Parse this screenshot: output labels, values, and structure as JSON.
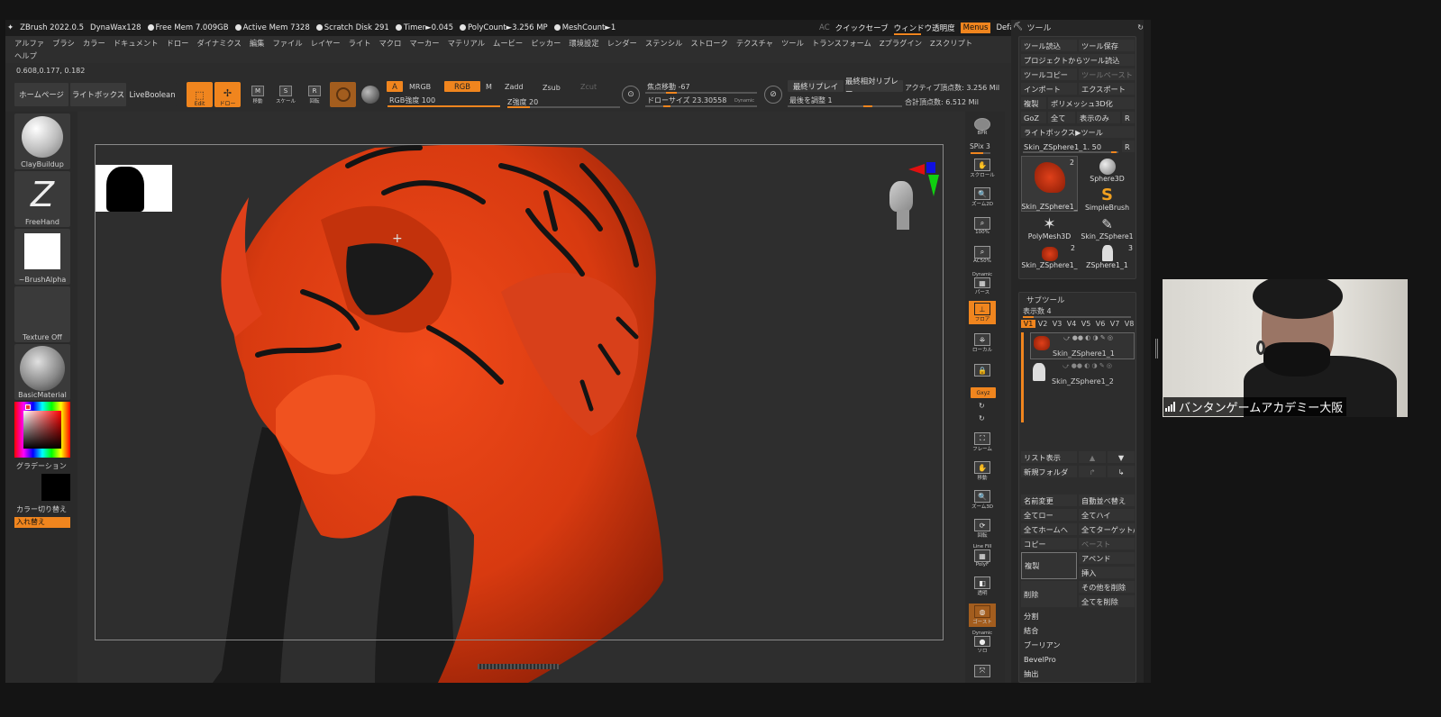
{
  "titlebar": {
    "items": [
      "ZBrush 2022.0.5",
      "DynaWax128"
    ],
    "stats": [
      "Free Mem 7.009GB",
      "Active Mem 7328",
      "Scratch Disk 291",
      "Timer►0.045",
      "PolyCount►3.256 MP",
      "MeshCount►1"
    ],
    "right": {
      "ac": "AC",
      "quicksave": "クイックセーブ",
      "transparency": "ウィンドウ透明度",
      "menus": "Menus",
      "script": "DefaultZScript"
    }
  },
  "menu": {
    "row1": [
      "アルファ",
      "ブラシ",
      "カラー",
      "ドキュメント",
      "ドロー",
      "ダイナミクス",
      "編集",
      "ファイル",
      "レイヤー",
      "ライト",
      "マクロ",
      "マーカー",
      "マテリアル",
      "ムービー",
      "ピッカー",
      "環境設定",
      "レンダー",
      "ステンシル",
      "ストローク",
      "テクスチャ",
      "ツール",
      "トランスフォーム",
      "Zプラグイン",
      "Zスクリプト"
    ],
    "row2": [
      "ヘルプ"
    ]
  },
  "coords": "0.608,0.177, 0.182",
  "toolbar": {
    "home": "ホームページ",
    "lightbox": "ライトボックス",
    "liveboolean": "LiveBoolean",
    "edit": "Edit",
    "draw": "ドロー",
    "move": "移動",
    "scale": "スケール",
    "rotate": "回転",
    "a": "A",
    "mrgb": "MRGB",
    "rgb": "RGB",
    "m": "M",
    "zadd": "Zadd",
    "zsub": "Zsub",
    "zcut": "Zcut",
    "rgb_intensity": "RGB強度 100",
    "z_intensity": "Z強度 20",
    "focal_shift": "焦点移動 -67",
    "draw_size": "ドローサイズ 23.30558",
    "dynamic": "Dynamic",
    "last_replay": "最終リプレイ",
    "last_relative_replay": "最終相対リプレー",
    "adjust_last": "最後を調整 1",
    "active_points": "アクティブ頂点数: 3.256 Mil",
    "total_points": "合計頂点数: 6.512 Mil",
    "rgb_intensity_value": 100,
    "z_intensity_value": 20
  },
  "leftpanel": {
    "brush": "ClayBuildup",
    "stroke": "FreeHand",
    "alpha": "~BrushAlpha",
    "texture": "Texture Off",
    "material": "BasicMaterial",
    "gradient": "グラデーション",
    "switch_color": "カラー切り替え",
    "swap": "入れ替え",
    "colors": {
      "accent": "#f0851e",
      "secondary_color": "#000000"
    }
  },
  "righttools": {
    "bpr": "BPR",
    "spix": "SPix 3",
    "scroll": "スクロール",
    "zoom2d": "ズーム2D",
    "zoom100": "100%",
    "ac50": "AC50%",
    "dynamic": "Dynamic",
    "persp": "パース",
    "floor": "フロア",
    "local": "ローカル",
    "xyz": "Gxyz",
    "frame": "フレーム",
    "move": "移動",
    "zoom3d": "ズーム3D",
    "rotate": "回転",
    "linefill": "Line Fill",
    "polyf": "PolyF",
    "transp": "透明",
    "ghost": "ゴースト",
    "solo": "ソロ"
  },
  "toolpanel": {
    "title": "ツール",
    "load_tool": "ツール読込",
    "save_tool": "ツール保存",
    "load_from_project": "プロジェクトからツール読込",
    "copy_tool": "ツールコピー",
    "paste_tool": "ツールペースト",
    "import": "インポート",
    "export": "エクスポート",
    "clone": "複製",
    "polymesh3d": "ポリメッシュ3D化",
    "goz": "GoZ",
    "all": "全て",
    "visible": "表示のみ",
    "r": "R",
    "lightbox_tools": "ライトボックス▶ツール",
    "current_tool": "Skin_ZSphere1_1. 50",
    "thumbs": [
      {
        "label": "Skin_ZSphere1_",
        "badge": "2"
      },
      {
        "label": "Sphere3D",
        "badge": ""
      },
      {
        "label": "SimpleBrush",
        "badge": ""
      },
      {
        "label": "PolyMesh3D",
        "badge": ""
      },
      {
        "label": "Skin_ZSphere1",
        "badge": ""
      },
      {
        "label": "Skin_ZSphere1_",
        "badge": "2"
      },
      {
        "label": "ZSphere1_1",
        "badge": "3"
      }
    ],
    "subtool": {
      "title": "サブツール",
      "visible_count": "表示数 4",
      "versions": [
        "V1",
        "V2",
        "V3",
        "V4",
        "V5",
        "V6",
        "V7",
        "V8"
      ],
      "items": [
        "Skin_ZSphere1_1",
        "Skin_ZSphere1_2"
      ]
    },
    "list_all": "リスト表示",
    "new_folder": "新規フォルダ",
    "rename": "名前変更",
    "auto_reorder": "自動並べ替え",
    "all_low": "全てロー",
    "all_high": "全てハイ",
    "all_to_home": "全てホームへ",
    "all_to_target": "全てターゲット/",
    "copy": "コピー",
    "paste": "ペースト",
    "append": "アペンド",
    "duplicate": "複製",
    "insert": "挿入",
    "delete": "削除",
    "del_other": "その他を削除",
    "del_all": "全てを削除",
    "split": "分割",
    "merge": "結合",
    "boolean": "ブーリアン",
    "bevelpro": "BevelPro",
    "extract": "抽出"
  },
  "webcam": {
    "label": "バンタンゲームアカデミー大阪"
  }
}
